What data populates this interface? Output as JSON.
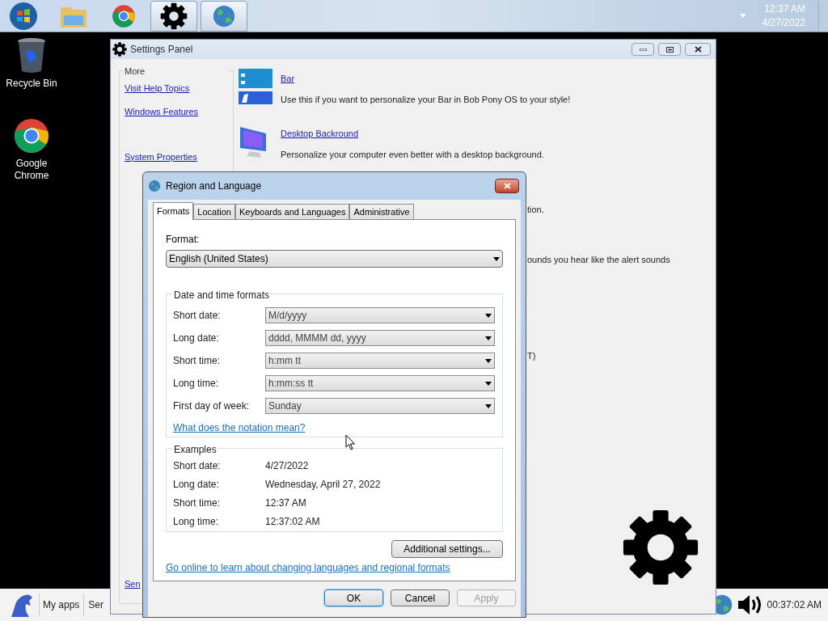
{
  "top_taskbar": {
    "items": [
      {
        "kind": "start",
        "running": false
      },
      {
        "kind": "folder",
        "running": false
      },
      {
        "kind": "chrome",
        "running": false
      },
      {
        "kind": "settings",
        "running": true
      },
      {
        "kind": "region",
        "running": true
      }
    ],
    "time": "12:37 AM",
    "date": "4/27/2022"
  },
  "desktop_icons": [
    {
      "kind": "recycle-bin",
      "label": "Recycle Bin"
    },
    {
      "kind": "chrome",
      "label": "Google Chrome"
    }
  ],
  "settings_window": {
    "title": "Settings Panel",
    "sidebar": {
      "heading": "More",
      "links": [
        "Visit Help Topics",
        "Windows Features",
        "System Properties",
        "Sen"
      ]
    },
    "items": [
      {
        "kind": "bar",
        "title": "Bar",
        "description": "Use this if you want to personalize your Bar in Bob Pony OS to your style!"
      },
      {
        "kind": "desktop",
        "title": "Desktop Backround",
        "description": "Personalize your computer even better with a desktop background."
      }
    ],
    "partial_texts": [
      "tion.",
      "ounds you hear like the alert sounds",
      "T)"
    ]
  },
  "dialog": {
    "title": "Region and Language",
    "tabs": [
      {
        "label": "Formats",
        "selected": true
      },
      {
        "label": "Location",
        "selected": false
      },
      {
        "label": "Keyboards and Languages",
        "selected": false
      },
      {
        "label": "Administrative",
        "selected": false
      }
    ],
    "format_label": "Format:",
    "format_value": "English (United States)",
    "date_time": {
      "title": "Date and time formats",
      "rows": [
        {
          "label": "Short date:",
          "value": "M/d/yyyy"
        },
        {
          "label": "Long date:",
          "value": "dddd, MMMM dd, yyyy"
        },
        {
          "label": "Short time:",
          "value": "h:mm tt"
        },
        {
          "label": "Long time:",
          "value": "h:mm:ss tt"
        },
        {
          "label": "First day of week:",
          "value": "Sunday"
        }
      ],
      "link": "What does the notation mean?"
    },
    "examples": {
      "title": "Examples",
      "rows": [
        {
          "label": "Short date:",
          "value": "4/27/2022"
        },
        {
          "label": "Long date:",
          "value": "Wednesday, April 27, 2022"
        },
        {
          "label": "Short time:",
          "value": "12:37 AM"
        },
        {
          "label": "Long time:",
          "value": "12:37:02 AM"
        }
      ]
    },
    "additional_button": "Additional settings...",
    "online_link": "Go online to learn about changing languages and regional formats",
    "buttons": [
      {
        "label": "OK",
        "disabled": false,
        "default": true
      },
      {
        "label": "Cancel",
        "disabled": false,
        "default": false
      },
      {
        "label": "Apply",
        "disabled": true,
        "default": false
      }
    ]
  },
  "bottom_taskbar": {
    "apps": [
      "My apps",
      "Ser"
    ],
    "clock": "00:37:02 AM"
  }
}
